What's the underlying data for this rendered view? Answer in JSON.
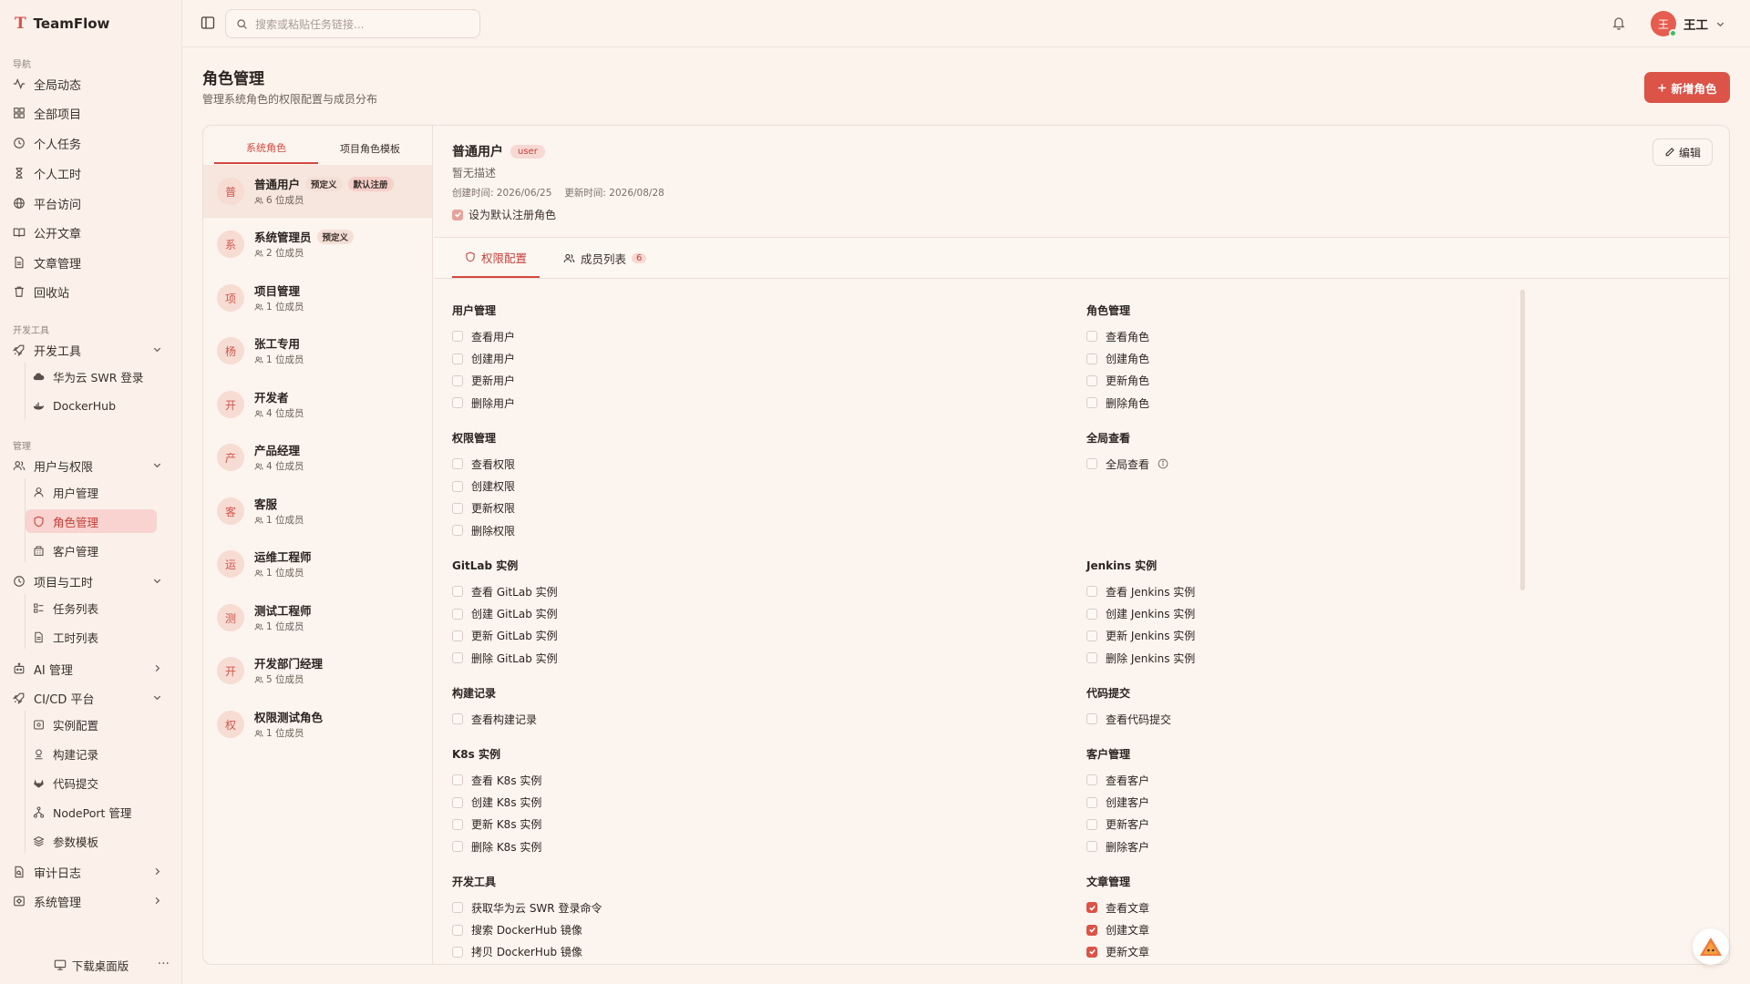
{
  "app": {
    "name": "TeamFlow"
  },
  "sidebar": {
    "sections": {
      "nav": "导航",
      "devtools": "开发工具",
      "manage": "管理"
    },
    "nav_items": [
      {
        "label": "全局动态",
        "icon": "activity-icon"
      },
      {
        "label": "全部项目",
        "icon": "grid-icon"
      },
      {
        "label": "个人任务",
        "icon": "clock-icon"
      },
      {
        "label": "个人工时",
        "icon": "hourglass-icon"
      },
      {
        "label": "平台访问",
        "icon": "globe-icon"
      },
      {
        "label": "公开文章",
        "icon": "book-open-icon"
      },
      {
        "label": "文章管理",
        "icon": "file-text-icon"
      },
      {
        "label": "回收站",
        "icon": "trash-icon"
      }
    ],
    "dev_group": {
      "label": "开发工具",
      "children": [
        "华为云 SWR 登录",
        "DockerHub"
      ]
    },
    "user_group": {
      "label": "用户与权限",
      "children": [
        "用户管理",
        "角色管理",
        "客户管理"
      ],
      "active": "角色管理"
    },
    "project_group": {
      "label": "项目与工时",
      "children": [
        "任务列表",
        "工时列表"
      ]
    },
    "ai": {
      "label": "AI 管理"
    },
    "cicd_group": {
      "label": "CI/CD 平台",
      "children": [
        "实例配置",
        "构建记录",
        "代码提交",
        "NodePort 管理",
        "参数模板"
      ]
    },
    "audit": {
      "label": "审计日志"
    },
    "system": {
      "label": "系统管理"
    },
    "footer": {
      "label": "下载桌面版",
      "more": "···"
    }
  },
  "topbar": {
    "search_placeholder": "搜索或粘贴任务链接...",
    "user_name": "王工",
    "avatar_initial": "王"
  },
  "page": {
    "title": "角色管理",
    "subtitle": "管理系统角色的权限配置与成员分布",
    "new_button": "新增角色"
  },
  "role_tabs": [
    "系统角色",
    "项目角色模板"
  ],
  "roles": [
    {
      "initial": "普",
      "name": "普通用户",
      "members": "6 位成员",
      "tags": [
        "预定义",
        "默认注册"
      ]
    },
    {
      "initial": "系",
      "name": "系统管理员",
      "members": "2 位成员",
      "tags": [
        "预定义"
      ]
    },
    {
      "initial": "项",
      "name": "项目管理",
      "members": "1 位成员",
      "tags": []
    },
    {
      "initial": "杨",
      "name": "张工专用",
      "members": "1 位成员",
      "tags": []
    },
    {
      "initial": "开",
      "name": "开发者",
      "members": "4 位成员",
      "tags": []
    },
    {
      "initial": "产",
      "name": "产品经理",
      "members": "4 位成员",
      "tags": []
    },
    {
      "initial": "客",
      "name": "客服",
      "members": "1 位成员",
      "tags": []
    },
    {
      "initial": "运",
      "name": "运维工程师",
      "members": "1 位成员",
      "tags": []
    },
    {
      "initial": "测",
      "name": "测试工程师",
      "members": "1 位成员",
      "tags": []
    },
    {
      "initial": "开",
      "name": "开发部门经理",
      "members": "5 位成员",
      "tags": []
    },
    {
      "initial": "权",
      "name": "权限测试角色",
      "members": "1 位成员",
      "tags": []
    }
  ],
  "role_detail": {
    "name": "普通用户",
    "code": "user",
    "description": "暂无描述",
    "created": "创建时间: 2026/06/25",
    "updated": "更新时间: 2026/08/28",
    "default_label": "设为默认注册角色",
    "default_checked": true,
    "edit_button": "编辑",
    "tabs": [
      {
        "label": "权限配置"
      },
      {
        "label": "成员列表",
        "count": "6"
      }
    ]
  },
  "permissions_left": [
    {
      "title": "用户管理",
      "items": [
        {
          "label": "查看用户",
          "checked": false
        },
        {
          "label": "创建用户",
          "checked": false
        },
        {
          "label": "更新用户",
          "checked": false
        },
        {
          "label": "删除用户",
          "checked": false
        }
      ]
    },
    {
      "title": "权限管理",
      "items": [
        {
          "label": "查看权限",
          "checked": false
        },
        {
          "label": "创建权限",
          "checked": false
        },
        {
          "label": "更新权限",
          "checked": false
        },
        {
          "label": "删除权限",
          "checked": false
        }
      ]
    },
    {
      "title": "GitLab 实例",
      "items": [
        {
          "label": "查看 GitLab 实例",
          "checked": false
        },
        {
          "label": "创建 GitLab 实例",
          "checked": false
        },
        {
          "label": "更新 GitLab 实例",
          "checked": false
        },
        {
          "label": "删除 GitLab 实例",
          "checked": false
        }
      ]
    },
    {
      "title": "构建记录",
      "items": [
        {
          "label": "查看构建记录",
          "checked": false
        }
      ]
    },
    {
      "title": "K8s 实例",
      "items": [
        {
          "label": "查看 K8s 实例",
          "checked": false
        },
        {
          "label": "创建 K8s 实例",
          "checked": false
        },
        {
          "label": "更新 K8s 实例",
          "checked": false
        },
        {
          "label": "删除 K8s 实例",
          "checked": false
        }
      ]
    },
    {
      "title": "开发工具",
      "items": [
        {
          "label": "获取华为云 SWR 登录命令",
          "checked": false
        },
        {
          "label": "搜索 DockerHub 镜像",
          "checked": false
        },
        {
          "label": "拷贝 DockerHub 镜像",
          "checked": false
        }
      ]
    }
  ],
  "permissions_right": [
    {
      "title": "角色管理",
      "items": [
        {
          "label": "查看角色",
          "checked": false
        },
        {
          "label": "创建角色",
          "checked": false
        },
        {
          "label": "更新角色",
          "checked": false
        },
        {
          "label": "删除角色",
          "checked": false
        }
      ]
    },
    {
      "title": "全局查看",
      "items": [
        {
          "label": "全局查看",
          "checked": false,
          "info": true
        }
      ]
    },
    {
      "title": "Jenkins 实例",
      "items": [
        {
          "label": "查看 Jenkins 实例",
          "checked": false
        },
        {
          "label": "创建 Jenkins 实例",
          "checked": false
        },
        {
          "label": "更新 Jenkins 实例",
          "checked": false
        },
        {
          "label": "删除 Jenkins 实例",
          "checked": false
        }
      ]
    },
    {
      "title": "代码提交",
      "items": [
        {
          "label": "查看代码提交",
          "checked": false
        }
      ]
    },
    {
      "title": "客户管理",
      "items": [
        {
          "label": "查看客户",
          "checked": false
        },
        {
          "label": "创建客户",
          "checked": false
        },
        {
          "label": "更新客户",
          "checked": false
        },
        {
          "label": "删除客户",
          "checked": false
        }
      ]
    },
    {
      "title": "文章管理",
      "items": [
        {
          "label": "查看文章",
          "checked": true
        },
        {
          "label": "创建文章",
          "checked": true
        },
        {
          "label": "更新文章",
          "checked": true
        }
      ]
    }
  ],
  "colors": {
    "accent": "#dc5347",
    "background": "#fcf3ec",
    "online": "#3cbf62"
  }
}
